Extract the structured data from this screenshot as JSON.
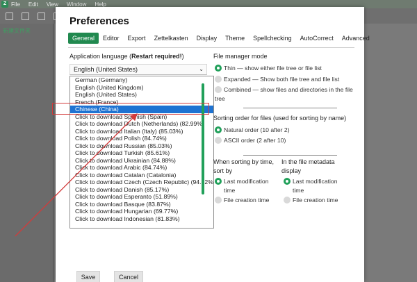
{
  "app": {
    "logo": "Z",
    "menu": [
      "File",
      "Edit",
      "View",
      "Window",
      "Help"
    ],
    "sidebar_file": "新建文件夹"
  },
  "dialog": {
    "title": "Preferences",
    "tabs": [
      "General",
      "Editor",
      "Export",
      "Zettelkasten",
      "Display",
      "Theme",
      "Spellchecking",
      "AutoCorrect",
      "Advanced"
    ],
    "active_tab": "General"
  },
  "language": {
    "label_prefix": "Application language (",
    "label_bold": "Restart required!",
    "label_suffix": ")",
    "selected": "English (United States)",
    "options": [
      "German (Germany)",
      "English (United Kingdom)",
      "English (United States)",
      "French (France)",
      "Chinese (China)",
      "Click to download Spanish (Spain)",
      "Click to download Dutch (Netherlands) (82.99%)",
      "Click to download Italian (Italy) (85.03%)",
      "Click to download Polish (84.74%)",
      "Click to download Russian (85.03%)",
      "Click to download Turkish (85.61%)",
      "Click to download Ukrainian (84.88%)",
      "Click to download Arabic (84.74%)",
      "Click to download Catalan (Catalonia)",
      "Click to download Czech (Czech Republic) (94.62%)",
      "Click to download Danish (85.17%)",
      "Click to download Esperanto (51.89%)",
      "Click to download Basque (83.87%)",
      "Click to download Hungarian (69.77%)",
      "Click to download Indonesian (81.83%)"
    ],
    "highlighted_option": "Chinese (China)"
  },
  "file_manager": {
    "heading": "File manager mode",
    "options": [
      {
        "line1": "Thin — show either file tree or file list",
        "line2": "",
        "selected": true
      },
      {
        "line1": "Expanded — Show both file tree and file list",
        "line2": "",
        "selected": false
      },
      {
        "line1": "Combined — show files and directories in the file",
        "line2": "tree",
        "selected": false
      }
    ]
  },
  "sorting": {
    "heading": "Sorting order for files (used for sorting by name)",
    "options": [
      {
        "label": "Natural order (10 after 2)",
        "selected": true
      },
      {
        "label": "ASCII order (2 after 10)",
        "selected": false
      }
    ]
  },
  "time_sort": {
    "heading_line1": "When sorting by time,",
    "heading_line2": "sort by",
    "options": [
      {
        "line1": "Last modification",
        "line2": "time",
        "selected": true
      },
      {
        "line1": "File creation time",
        "line2": "",
        "selected": false
      }
    ]
  },
  "metadata": {
    "heading_line1": "In the file metadata",
    "heading_line2": "display",
    "options": [
      {
        "line1": "Last modification",
        "line2": "time",
        "selected": true
      },
      {
        "line1": "File creation time",
        "line2": "",
        "selected": false
      }
    ]
  },
  "buttons": {
    "save": "Save",
    "cancel": "Cancel"
  },
  "colors": {
    "accent": "#21894f",
    "highlight": "#1e73d2",
    "annotation": "#d23b3b"
  }
}
